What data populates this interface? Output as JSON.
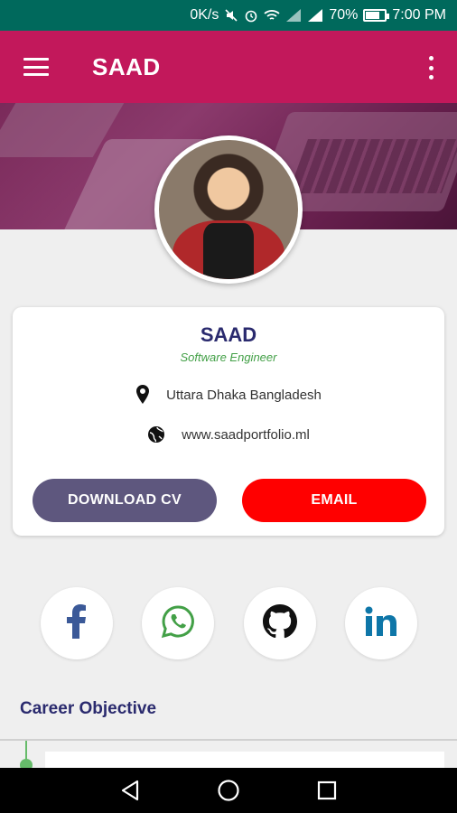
{
  "status_bar": {
    "speed": "0K/s",
    "battery_percent": "70%",
    "time": "7:00 PM",
    "background": "#00695c"
  },
  "app_bar": {
    "title": "SAAD",
    "background": "#c2185b",
    "menu_icon": "hamburger-menu-icon",
    "more_icon": "more-vert-icon"
  },
  "profile": {
    "name": "SAAD",
    "role": "Software Engineer",
    "location": "Uttara Dhaka Bangladesh",
    "website": "www.saadportfolio.ml",
    "location_icon": "location-pin-icon",
    "website_icon": "globe-icon"
  },
  "actions": {
    "download_cv_label": "DOWNLOAD CV",
    "email_label": "EMAIL",
    "download_cv_color": "#5e577e",
    "email_color": "#ff0000"
  },
  "social": [
    {
      "name": "facebook",
      "icon": "facebook-icon",
      "color": "#3b5998"
    },
    {
      "name": "whatsapp",
      "icon": "whatsapp-icon",
      "color": "#43a047"
    },
    {
      "name": "github",
      "icon": "github-icon",
      "color": "#000000"
    },
    {
      "name": "linkedin",
      "icon": "linkedin-icon",
      "color": "#0e76a8"
    }
  ],
  "sections": {
    "career_objective_title": "Career Objective"
  },
  "nav_bar": {
    "back_icon": "back-triangle-icon",
    "home_icon": "home-circle-icon",
    "recents_icon": "recents-square-icon"
  }
}
